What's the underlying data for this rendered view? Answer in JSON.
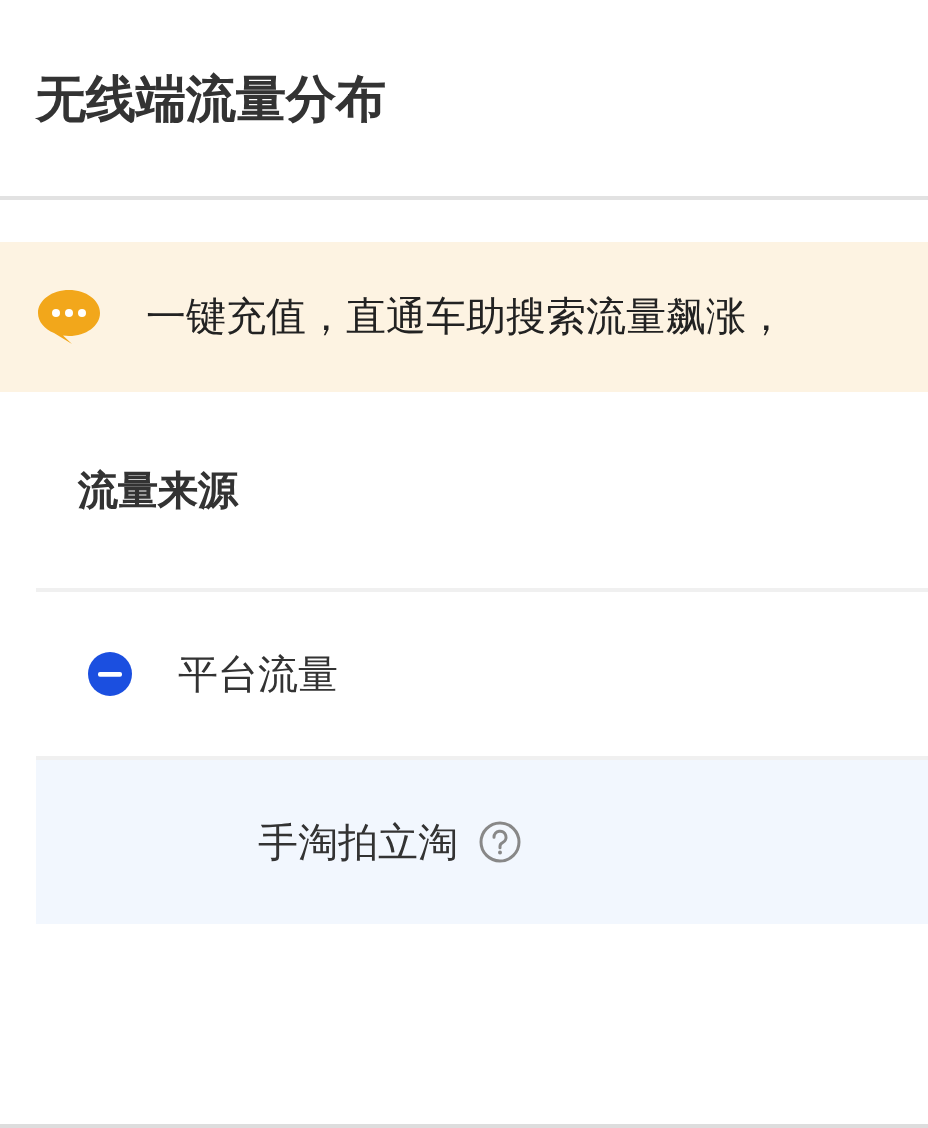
{
  "title": "无线端流量分布",
  "banner": {
    "text": "一键充值，直通车助搜索流量飙涨，"
  },
  "table": {
    "columns": [
      {
        "label": "流量来源"
      }
    ],
    "rows": [
      {
        "label": "平台流量",
        "expanded": true,
        "selected": false,
        "children": [
          {
            "label": "手淘拍立淘",
            "has_help": true,
            "selected": true
          }
        ]
      }
    ]
  }
}
